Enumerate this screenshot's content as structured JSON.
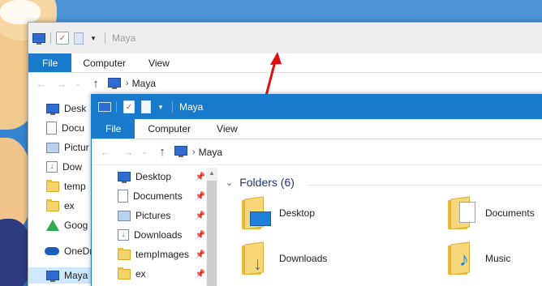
{
  "back_window": {
    "title": "Maya",
    "tabs": [
      "File",
      "Computer",
      "View"
    ],
    "address": "Maya",
    "nav_items": [
      "Desk",
      "Docu",
      "Pictur",
      "Dow",
      "temp",
      "ex",
      "Goog",
      "OneDr",
      "Maya"
    ]
  },
  "front_window": {
    "title": "Maya",
    "tabs": [
      "File",
      "Computer",
      "View"
    ],
    "address": "Maya",
    "nav_items": [
      {
        "label": "Desktop",
        "icon": "desktop-icon"
      },
      {
        "label": "Documents",
        "icon": "documents-icon"
      },
      {
        "label": "Pictures",
        "icon": "pictures-icon"
      },
      {
        "label": "Downloads",
        "icon": "downloads-icon"
      },
      {
        "label": "tempImages",
        "icon": "folder-icon"
      },
      {
        "label": "ex",
        "icon": "folder-icon"
      }
    ],
    "group_title": "Folders (6)",
    "folders": [
      {
        "label": "Desktop",
        "icon": "desktop-folder-icon"
      },
      {
        "label": "Documents",
        "icon": "documents-folder-icon"
      },
      {
        "label": "Downloads",
        "icon": "downloads-folder-icon"
      },
      {
        "label": "Music",
        "icon": "music-folder-icon"
      }
    ]
  },
  "colors": {
    "accent": "#1979ca",
    "arrow": "#e01010",
    "folder": "#f4d36b"
  }
}
